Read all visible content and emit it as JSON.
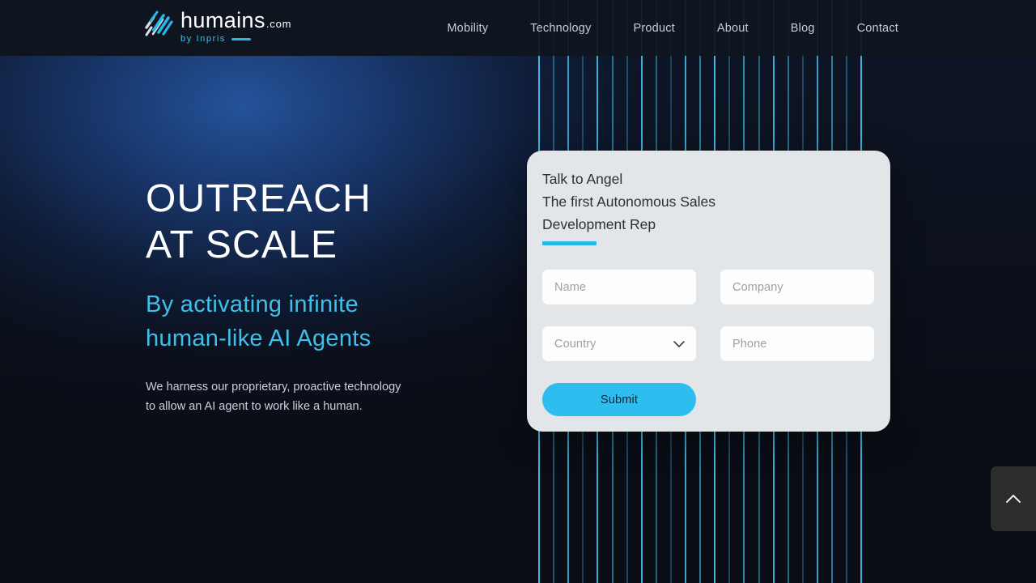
{
  "header": {
    "logo": {
      "mark_icon": "diagonal-slashes-logo-icon",
      "name": "humains",
      "tld": ".com",
      "tagline": "by Inpris"
    },
    "nav": [
      {
        "label": "Mobility"
      },
      {
        "label": "Technology"
      },
      {
        "label": "Product"
      },
      {
        "label": "About"
      },
      {
        "label": "Blog"
      },
      {
        "label": "Contact"
      }
    ]
  },
  "hero": {
    "headline": "OUTREACH\nAT SCALE",
    "subheadline": "By activating infinite\nhuman-like AI Agents",
    "body": "We harness our proprietary, proactive technology\nto allow an AI agent to work like a human."
  },
  "form_card": {
    "title": "Talk to Angel\nThe first Autonomous Sales\nDevelopment Rep",
    "fields": {
      "name": {
        "placeholder": "Name",
        "value": ""
      },
      "company": {
        "placeholder": "Company",
        "value": ""
      },
      "country": {
        "placeholder": "Country",
        "value": "",
        "chevron_icon": "chevron-down-icon"
      },
      "phone": {
        "placeholder": "Phone",
        "value": ""
      }
    },
    "submit_label": "Submit"
  },
  "scroll_top": {
    "icon": "chevron-up-icon"
  },
  "colors": {
    "accent_cyan": "#3FC0EA",
    "button_cyan": "#2DBEEF",
    "header_bg": "#101620",
    "page_bg": "#0B0F17",
    "card_bg": "#E3E6E9",
    "heading_white": "#FFFFFF",
    "body_gray": "#C9D1DC"
  }
}
